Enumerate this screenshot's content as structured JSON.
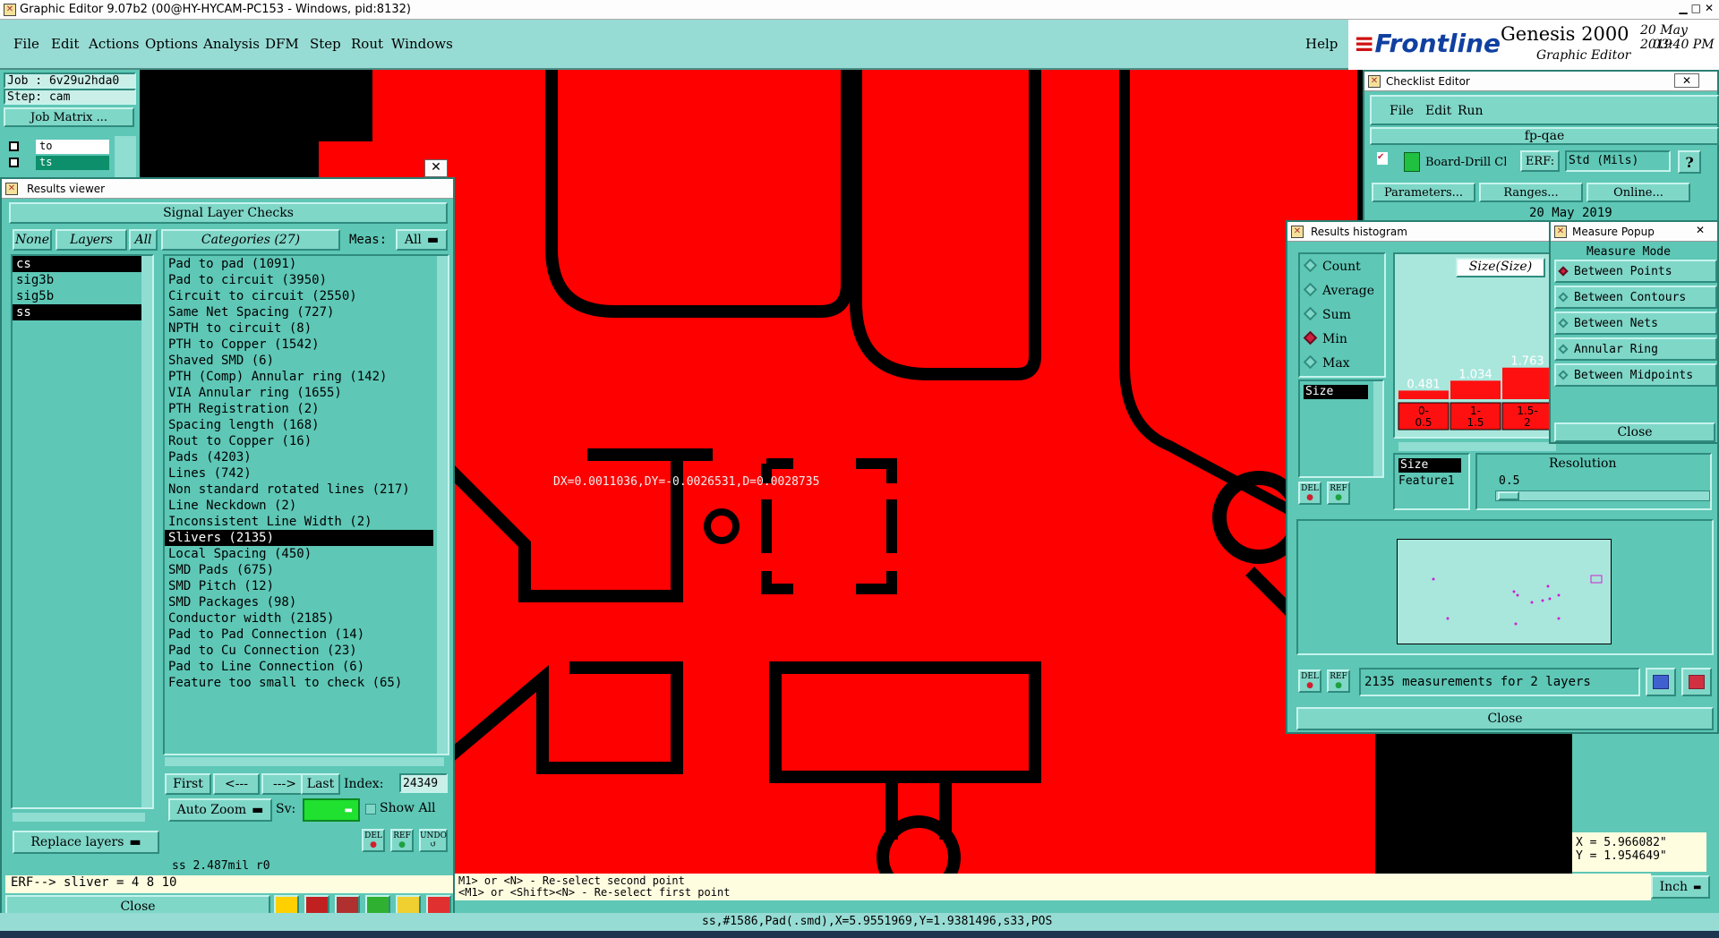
{
  "window": {
    "title": "Graphic Editor 9.07b2 (00@HY-HYCAM-PC153 - Windows, pid:8132)"
  },
  "menu": [
    "File",
    "Edit",
    "Actions",
    "Options",
    "Analysis",
    "DFM",
    "Step",
    "Rout",
    "Windows"
  ],
  "help": "Help",
  "brand": {
    "logo": "Frontline",
    "product": "Genesis 2000",
    "sub": "Graphic Editor",
    "date": "20 May 2019",
    "time": "03:40 PM"
  },
  "job": {
    "job": "Job : 6v29u2hda0",
    "step": "Step: cam",
    "matrix": "Job Matrix ...",
    "layer1": "to",
    "layer2": "ts"
  },
  "results_viewer": {
    "title": "Results viewer",
    "header": "Signal Layer Checks",
    "none": "None",
    "layers": "Layers",
    "all": "All",
    "categories_label": "Categories (27)",
    "meas_label": "Meas:",
    "meas_value": "All",
    "layer_list": [
      "cs",
      "sig3b",
      "sig5b",
      "ss"
    ],
    "categories": [
      "Pad to pad (1091)",
      "Pad to circuit (3950)",
      "Circuit to circuit (2550)",
      "Same Net Spacing (727)",
      "NPTH to circuit (8)",
      "PTH to Copper (1542)",
      "Shaved SMD (6)",
      "PTH (Comp) Annular ring (142)",
      "VIA Annular ring (1655)",
      "PTH Registration (2)",
      "Spacing length (168)",
      "Rout to Copper (16)",
      "Pads (4203)",
      "Lines (742)",
      "Non standard rotated lines (217)",
      "Line Neckdown (2)",
      "Inconsistent Line Width (2)",
      "Slivers (2135)",
      "Local Spacing (450)",
      "SMD Pads (675)",
      "SMD Pitch (12)",
      "SMD Packages (98)",
      "Conductor width (2185)",
      "Pad to Pad Connection (14)",
      "Pad to Cu Connection (23)",
      "Pad to Line Connection (6)",
      "Feature too small to check (65)"
    ],
    "selected_category": "Slivers (2135)",
    "nav": {
      "first": "First",
      "prev": "<---",
      "next": "--->",
      "last": "Last",
      "index_label": "Index:",
      "index_value": "24349"
    },
    "auto_zoom": "Auto Zoom",
    "sv": "Sv:",
    "show_all": "Show All",
    "replace_layers": "Replace layers",
    "status": "ss 2.487mil  r0",
    "erf": "ERF--> sliver = 4 8 10",
    "close": "Close",
    "del": "DEL",
    "ref": "REF",
    "undo": "UNDO"
  },
  "canvas": {
    "measure_text": "DX=0.0011036,DY=-0.0026531,D=0.0028735"
  },
  "checklist": {
    "title": "Checklist Editor",
    "menu": [
      "File",
      "Edit",
      "Run"
    ],
    "name": "fp-qae",
    "board_drill": "Board-Drill Che",
    "erf": "ERF:",
    "std": "Std (Mils)",
    "q": "?",
    "parameters": "Parameters...",
    "ranges": "Ranges...",
    "online": "Online...",
    "date": "20 May 2019"
  },
  "histogram": {
    "title": "Results histogram",
    "modes": [
      "Count",
      "Average",
      "Sum",
      "Min",
      "Max"
    ],
    "selected_mode": "Min",
    "attr": "Size",
    "chart_title": "Size(Size)",
    "bars": [
      {
        "label": "0-0.5",
        "value": 0.481
      },
      {
        "label": "1-1.5",
        "value": 1.034
      },
      {
        "label": "1.5-2",
        "value": 1.763
      }
    ],
    "bar_labels": [
      "0.481",
      "1.034",
      "1.763"
    ],
    "bin_labels": [
      "0-\n0.5",
      "1-\n1.5",
      "1.5-\n2"
    ],
    "list2": [
      "Size",
      "Feature1"
    ],
    "resolution_label": "Resolution",
    "resolution": "0.5",
    "summary": "2135 measurements for 2 layers",
    "close": "Close",
    "del": "DEL",
    "ref": "REF"
  },
  "measure": {
    "title": "Measure Popup",
    "mode_label": "Measure Mode",
    "modes": [
      "Between Points",
      "Between Contours",
      "Between Nets",
      "Annular Ring",
      "Between Midpoints"
    ],
    "selected": "Between Points",
    "close": "Close"
  },
  "coords": {
    "x": "X = 5.966082\"",
    "y": "Y = 1.954649\""
  },
  "prompt": {
    "line1": "M1> or <N> - Re-select second point",
    "line2": "<M1> or <Shift><N> - Re-select first point"
  },
  "unit": "Inch",
  "statusbar": "ss,#1586,Pad(.smd),X=5.9551969,Y=1.9381496,s33,POS",
  "colors": {
    "copper": "#ff0000",
    "panel": "#5ec7b6",
    "menubar": "#97dcd4"
  }
}
